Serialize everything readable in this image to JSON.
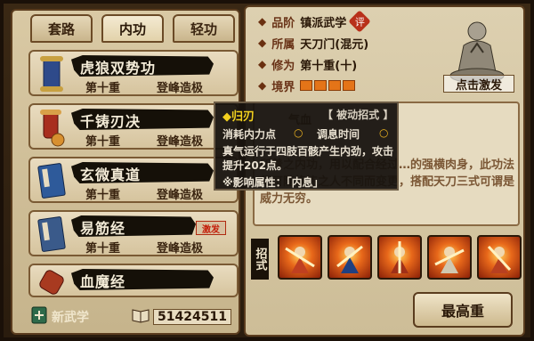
{
  "tabs": [
    {
      "label": "套路"
    },
    {
      "label": "内功"
    },
    {
      "label": "轻功"
    }
  ],
  "skills": [
    {
      "name": "虎狼双势功",
      "level": "第十重",
      "rank": "登峰造极",
      "icon": "scroll-icon"
    },
    {
      "name": "千铸刃决",
      "level": "第十重",
      "rank": "登峰造极",
      "icon": "scroll-icon"
    },
    {
      "name": "玄微真道",
      "level": "第十重",
      "rank": "登峰造极",
      "icon": "book-icon"
    },
    {
      "name": "易筋经",
      "level": "第十重",
      "rank": "登峰造极",
      "icon": "book-icon",
      "badge": "激发"
    },
    {
      "name": "血魔经",
      "level": "",
      "rank": "",
      "icon": "scroll-icon"
    }
  ],
  "footer": {
    "new_skill_label": "新武学",
    "points": "51424511"
  },
  "info": {
    "grade_label": "品阶",
    "grade_value": "镇派武学",
    "grade_badge": "评",
    "school_label": "所属",
    "school_value": "天刀门(混元)",
    "cultivation_label": "修为",
    "cultivation_value": "第十重(十)",
    "realm_label": "境界",
    "realm_segments": 4
  },
  "portrait": {
    "label": "点击激发"
  },
  "description": {
    "header": "气血",
    "text": "所着之内功，用以配合经过…的强横肉身，此功法便可随修炼之人不同而变更，搭配天刀三式可谓是威力无穷。"
  },
  "moves": {
    "label": "招式",
    "count": 5
  },
  "max_button": "最高重",
  "tooltip": {
    "title": "◆归刃",
    "type": "【 被动招式 】",
    "cost_label": "消耗内力点",
    "cost_value": "○",
    "time_label": "调息时间",
    "time_value": "○",
    "desc": "真气运行于四肢百骸产生内劲，攻击提升202点。",
    "attr": "※影响属性：「内息」"
  },
  "colors": {
    "realm_bar": "#e47418",
    "tooltip_title": "#f2d01e",
    "badge_red": "#c41e0a"
  }
}
